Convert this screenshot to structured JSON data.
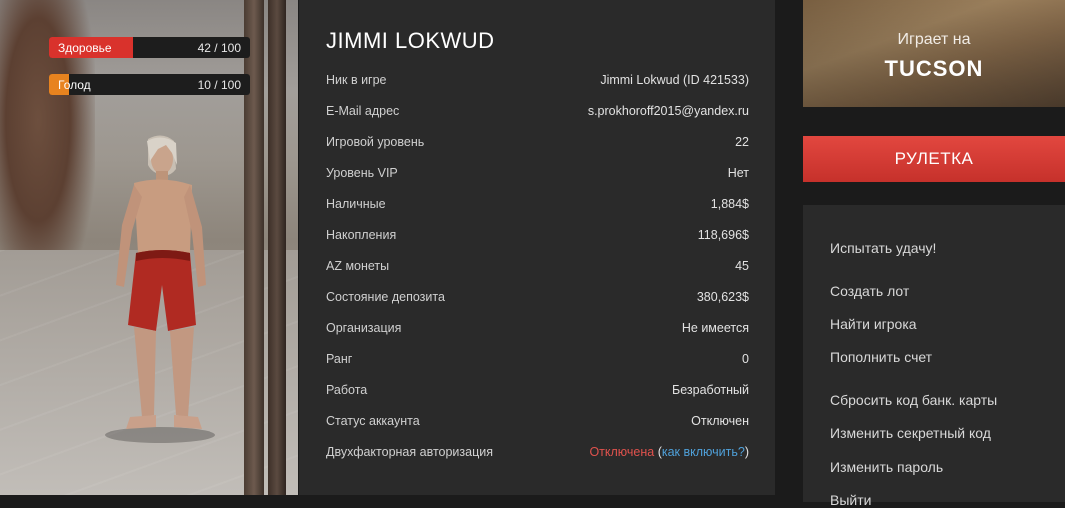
{
  "stats": {
    "health": {
      "label": "Здоровье",
      "value": "42 / 100",
      "fraction": 0.42,
      "color": "#d9322c"
    },
    "hunger": {
      "label": "Голод",
      "value": "10 / 100",
      "fraction": 0.1,
      "color": "#e8831f"
    }
  },
  "profile": {
    "title": "JIMMI LOKWUD",
    "rows": [
      {
        "key": "Ник в игре",
        "value": "Jimmi Lokwud (ID 421533)"
      },
      {
        "key": "E-Mail адрес",
        "value": "s.prokhoroff2015@yandex.ru"
      },
      {
        "key": "Игровой уровень",
        "value": "22"
      },
      {
        "key": "Уровень VIP",
        "value": "Нет"
      },
      {
        "key": "Наличные",
        "value": "1,884$"
      },
      {
        "key": "Накопления",
        "value": "118,696$"
      },
      {
        "key": "AZ монеты",
        "value": "45"
      },
      {
        "key": "Состояние депозита",
        "value": "380,623$"
      },
      {
        "key": "Организация",
        "value": "Не имеется"
      },
      {
        "key": "Ранг",
        "value": "0"
      },
      {
        "key": "Работа",
        "value": "Безработный"
      },
      {
        "key": "Статус аккаунта",
        "value": "Отключен"
      }
    ],
    "twofa": {
      "key": "Двухфакторная авторизация",
      "status": "Отключена",
      "open_paren": " (",
      "link": "как включить?",
      "close_paren": ")"
    }
  },
  "server": {
    "plays_on": "Играет на",
    "name": "TUCSON"
  },
  "roulette_label": "РУЛЕТКА",
  "menu": {
    "items": [
      "Испытать удачу!",
      "Создать лот",
      "Найти игрока",
      "Пополнить счет",
      "Сбросить код банк. карты",
      "Изменить секретный код",
      "Изменить пароль",
      "Выйти"
    ]
  },
  "colors": {
    "accent_red": "#d9322c",
    "link_blue": "#4fa0d9",
    "warning_red": "#e0524d"
  }
}
